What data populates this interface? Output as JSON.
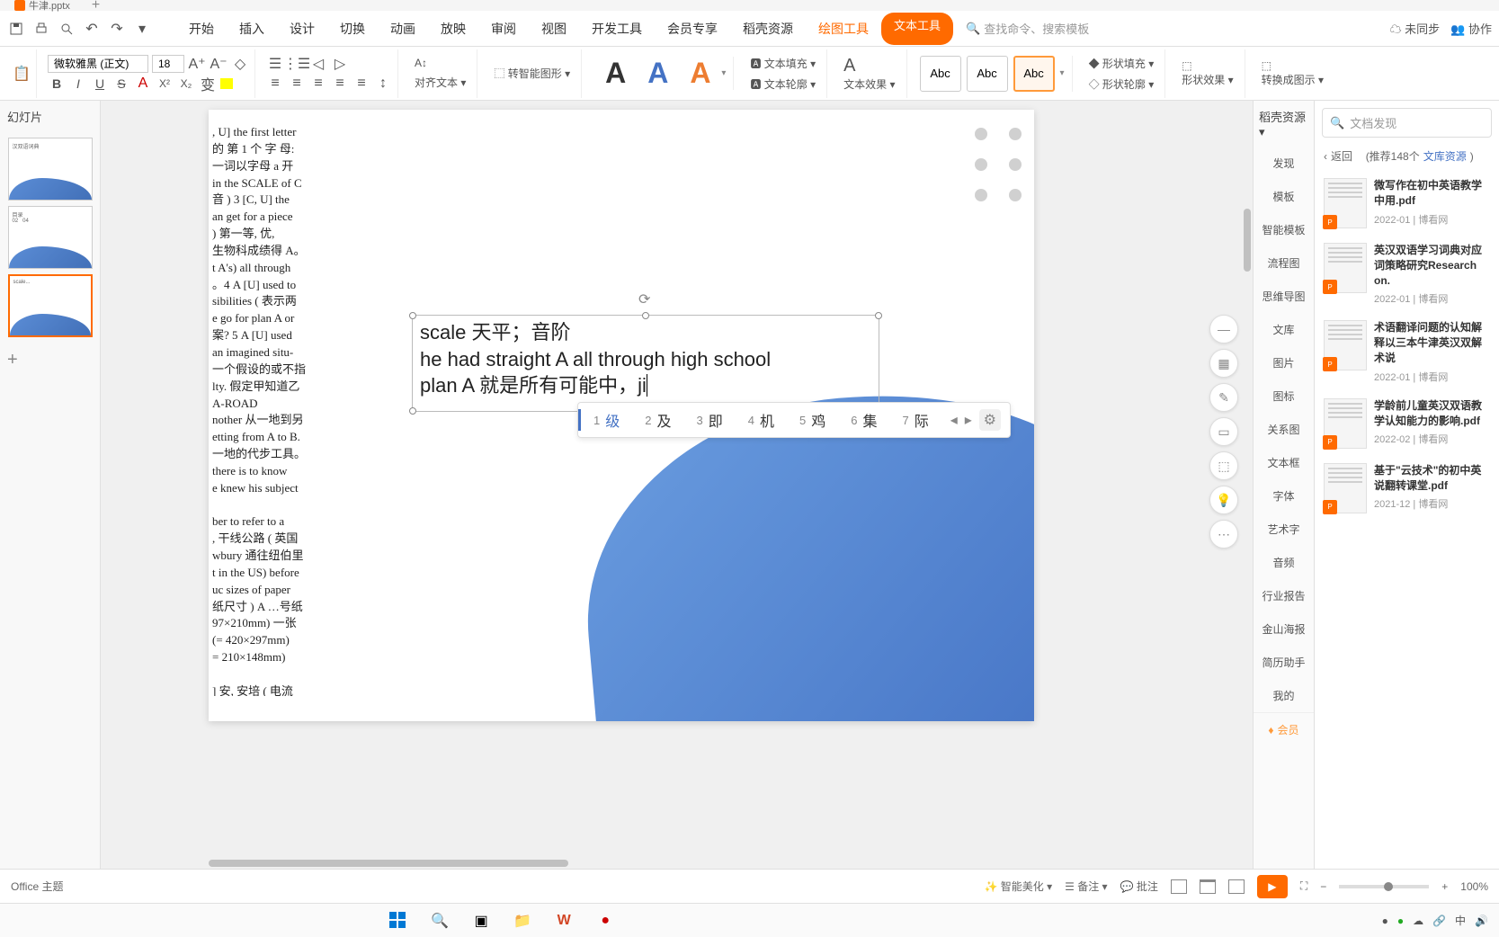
{
  "title_bar": {
    "tab_name": "牛津.pptx"
  },
  "menu": {
    "tabs": [
      "开始",
      "插入",
      "设计",
      "切换",
      "动画",
      "放映",
      "审阅",
      "视图",
      "开发工具",
      "会员专享",
      "稻壳资源"
    ],
    "draw_tool": "绘图工具",
    "text_tool": "文本工具",
    "search_hint": "查找命令、搜索模板",
    "unsync": "未同步",
    "coop": "协作"
  },
  "ribbon": {
    "font_name": "微软雅黑 (正文)",
    "font_size": "18",
    "align_text": "对齐文本",
    "smart_graphic": "转智能图形",
    "text_fill": "文本填充",
    "text_outline": "文本轮廓",
    "text_effect": "文本效果",
    "style_box": "Abc",
    "shape_fill": "形状填充",
    "shape_outline": "形状轮廓",
    "shape_effect": "形状效果",
    "convert_graphic": "转换成图示"
  },
  "slides_header": "幻灯片",
  "thumbs": [
    {
      "t": "汉双语词典"
    },
    {
      "t": "目录 02 04"
    },
    {
      "t": "scale..."
    }
  ],
  "bg_text": ", U] the first letter\n的 第 1 个 字 母:\n一词以字母 a 开\nin the SCALE of C\n音 ) 3 [C, U] the\nan get for a piece\n) 第一等, 优,\n生物科成绩得 A。\nt A's) all through\n。4 A [U] used to\nsibilities ( 表示两\ne go for plan A or\n案? 5 A [U] used\nan imagined situ-\n一个假设的或不指\nlty. 假定甲知道乙\nA-ROAD\nnother 从一地到另\netting from A to B.\n一地的代步工具。\nthere is to know\ne knew his subject\n\nber to refer to a\n, 干线公路 ( 英国\nwbury 通往纽伯里\nt in the US) before\nuc sizes of paper\n纸尺寸 ) A …号纸\n97×210mm) 一张\n(= 420×297mm)\n= 210×148mm)\n\n] 安, 安培 ( 电流",
  "textbox": {
    "line1": "scale  天平；音阶",
    "line2": "he had straight A all through high school",
    "line3": "plan A 就是所有可能中，ji"
  },
  "ime": {
    "candidates": [
      {
        "n": "1",
        "t": "级"
      },
      {
        "n": "2",
        "t": "及"
      },
      {
        "n": "3",
        "t": "即"
      },
      {
        "n": "4",
        "t": "机"
      },
      {
        "n": "5",
        "t": "鸡"
      },
      {
        "n": "6",
        "t": "集"
      },
      {
        "n": "7",
        "t": "际"
      }
    ]
  },
  "right_tabs_header": "稻壳资源",
  "right_tabs": [
    "发现",
    "模板",
    "智能模板",
    "流程图",
    "思维导图",
    "文库",
    "图片",
    "图标",
    "关系图",
    "文本框",
    "字体",
    "艺术字",
    "音频",
    "行业报告",
    "金山海报",
    "简历助手",
    "我的"
  ],
  "right_member": "会员",
  "res_search": "文档发现",
  "res_back": "返回",
  "res_rec_prefix": "(推荐148个",
  "res_rec_link": "文库资源",
  "resources": [
    {
      "title": "微写作在初中英语教学中用.pdf",
      "date": "2022-01",
      "src": "博看网"
    },
    {
      "title": "英汉双语学习词典对应词策略研究Research on.",
      "date": "2022-01",
      "src": "博看网"
    },
    {
      "title": "术语翻译问题的认知解释以三本牛津英汉双解术说",
      "date": "2022-01",
      "src": "博看网"
    },
    {
      "title": "学龄前儿童英汉双语教学认知能力的影响.pdf",
      "date": "2022-02",
      "src": "博看网"
    },
    {
      "title": "基于\"云技术\"的初中英说翻转课堂.pdf",
      "date": "2021-12",
      "src": "博看网"
    }
  ],
  "status": {
    "theme": "Office 主题",
    "beautify": "智能美化",
    "notes": "备注",
    "comments": "批注",
    "zoom": "100%"
  },
  "taskbar": {
    "ime": "中"
  }
}
